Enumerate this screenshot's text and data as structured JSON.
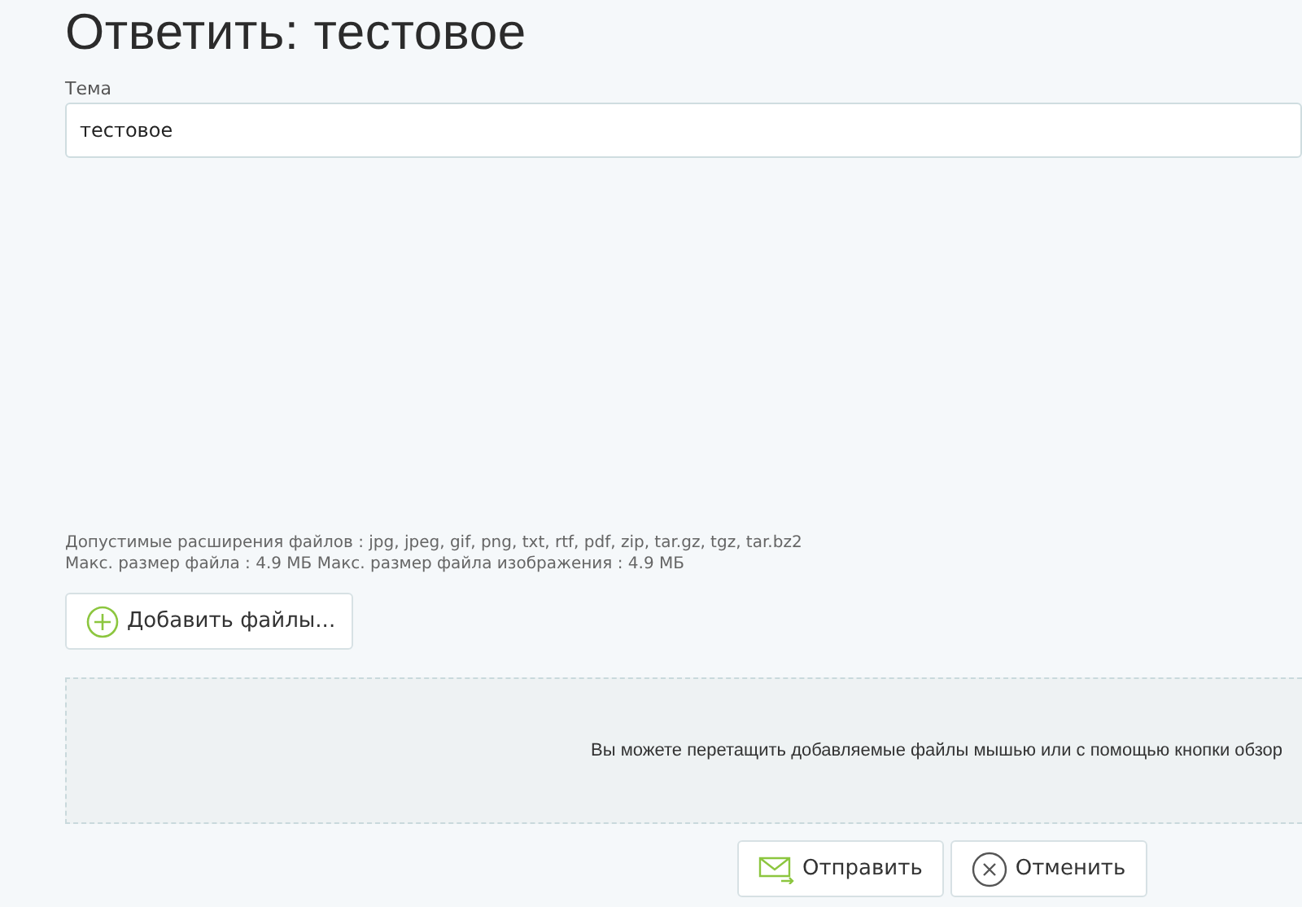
{
  "title": "Ответить: тестовое",
  "subject": {
    "label": "Тема",
    "value": "тестовое"
  },
  "file_info": [
    "Допустимые расширения файлов : jpg, jpeg, gif, png, txt, rtf, pdf, zip, tar.gz, tgz, tar.bz2",
    "Макс. размер файла : 4.9 МБ Макс. размер файла изображения : 4.9 МБ"
  ],
  "add_files_button": "Добавить файлы...",
  "dropzone": "Вы можете перетащить добавляемые файлы мышью или с помощью кнопки обзор",
  "buttons": [
    {
      "kind": "send",
      "label": "Отправить"
    },
    {
      "kind": "cancel",
      "label": "Отменить"
    }
  ]
}
